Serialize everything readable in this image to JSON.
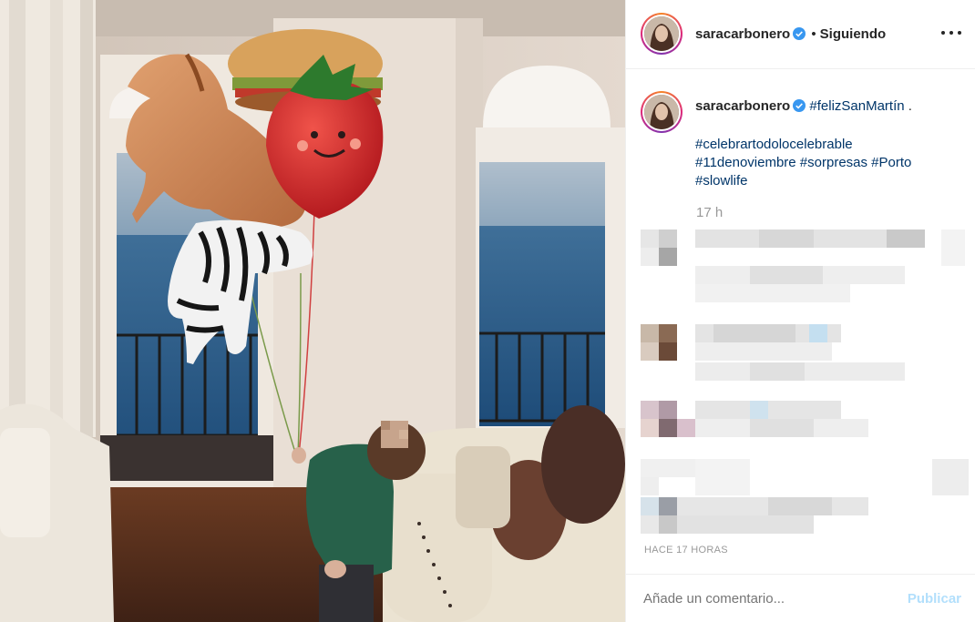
{
  "post": {
    "username": "saracarbonero",
    "separator": "•",
    "follow_status": "Siguiendo",
    "caption_hashtag": "#felizSanMartín",
    "caption_end": " .",
    "hashtags_line1": "#celebrartodolocelebrable",
    "hashtags_line2": "#11denoviembre #sorpresas #Porto",
    "hashtags_line3": "#slowlife",
    "time_ago": "17 h",
    "timestamp": "HACE 17 HORAS"
  },
  "composer": {
    "placeholder": "Añade un comentario...",
    "publish_label": "Publicar"
  },
  "colors": {
    "link": "#003569",
    "verified_badge": "#3897f0",
    "publish_disabled": "#b2dffc",
    "muted_text": "#999999"
  },
  "icons": [
    "verified-badge-icon",
    "more-options-icon"
  ]
}
